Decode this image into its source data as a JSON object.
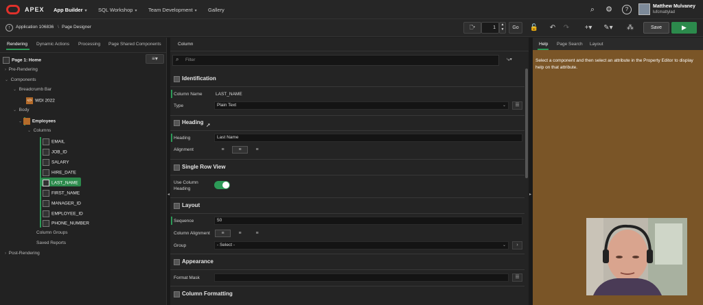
{
  "topbar": {
    "brand": "APEX",
    "nav": [
      {
        "label": "App Builder",
        "active": true
      },
      {
        "label": "SQL Workshop",
        "active": false
      },
      {
        "label": "Team Development",
        "active": false
      },
      {
        "label": "Gallery",
        "active": false
      }
    ],
    "user_name": "Matthew Mulvaney",
    "user_handle": "lufcmattylad"
  },
  "toolbar": {
    "breadcrumb_app": "Application 106836",
    "breadcrumb_page": "Page Designer",
    "page_number": "1",
    "go_label": "Go",
    "save_label": "Save"
  },
  "left": {
    "tabs": [
      "Rendering",
      "Dynamic Actions",
      "Processing",
      "Page Shared Components"
    ],
    "active_tab": "Rendering",
    "page_title": "Page 1: Home",
    "tree": {
      "pre_rendering": "Pre-Rendering",
      "components": "Components",
      "breadcrumb_bar": "Breadcrumb Bar",
      "wdi": "WDI 2022",
      "body": "Body",
      "employees": "Employees",
      "columns": "Columns",
      "column_items": [
        "EMAIL",
        "JOB_ID",
        "SALARY",
        "HIRE_DATE",
        "LAST_NAME",
        "FIRST_NAME",
        "MANAGER_ID",
        "EMPLOYEE_ID",
        "PHONE_NUMBER"
      ],
      "selected_column": "LAST_NAME",
      "column_groups": "Column Groups",
      "saved_reports": "Saved Reports",
      "post_rendering": "Post-Rendering"
    }
  },
  "center": {
    "header": "Column",
    "filter_placeholder": "Filter",
    "sections": {
      "identification": "Identification",
      "heading": "Heading",
      "single_row_view": "Single Row View",
      "layout": "Layout",
      "appearance": "Appearance",
      "column_formatting": "Column Formatting"
    },
    "labels": {
      "column_name": "Column Name",
      "type": "Type",
      "heading": "Heading",
      "alignment": "Alignment",
      "use_column_heading_1": "Use Column",
      "use_column_heading_2": "Heading",
      "sequence": "Sequence",
      "column_alignment": "Column Alignment",
      "group": "Group",
      "format_mask": "Format Mask"
    },
    "values": {
      "column_name": "LAST_NAME",
      "type": "Plain Text",
      "heading": "Last Name",
      "use_column_heading": true,
      "sequence": "50",
      "group": "- Select -",
      "format_mask": ""
    }
  },
  "right": {
    "tabs": [
      "Help",
      "Page Search",
      "Layout"
    ],
    "active_tab": "Help",
    "help_text": "Select a component and then select an attribute in the Property Editor to display help on that attribute."
  },
  "colors": {
    "accent_green": "#2c9a57",
    "help_bg": "#7a5527",
    "oracle_red": "#e0312b"
  }
}
